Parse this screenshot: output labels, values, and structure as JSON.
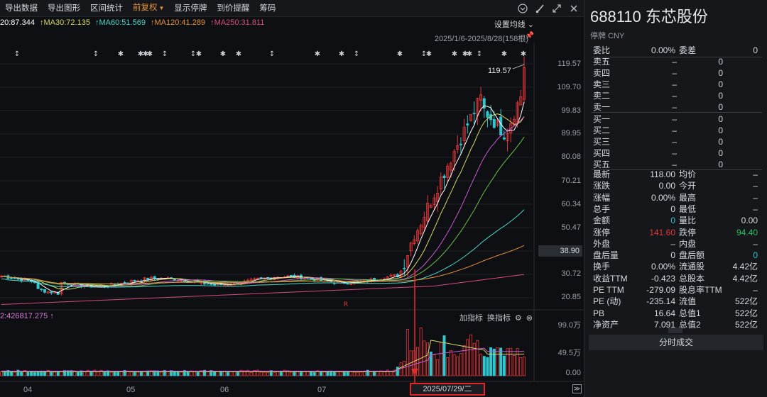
{
  "toolbar": {
    "items": [
      "导出数据",
      "导出图形",
      "区间统计",
      "前复权",
      "显示停牌",
      "到价提醒",
      "筹码"
    ],
    "active_index": 3,
    "icons": [
      "chevron-circle-icon",
      "brush-icon",
      "expand-icon",
      "close-icon"
    ]
  },
  "ma": [
    {
      "label": "20:87.344",
      "color": "#ffffff"
    },
    {
      "label": "↑MA30:72.135",
      "color": "#d7d86a"
    },
    {
      "label": "↑MA60:51.569",
      "color": "#4dd6c8"
    },
    {
      "label": "↑MA120:41.289",
      "color": "#e5923a"
    },
    {
      "label": "↑MA250:31.811",
      "color": "#d94b7c"
    }
  ],
  "settings_ma": "设置均线",
  "date_range": "2025/1/6-2025/8/28(158根)",
  "price_axis": [
    "119.57",
    "109.70",
    "99.83",
    "89.95",
    "80.08",
    "70.21",
    "60.34",
    "50.47",
    "40.59",
    "30.72",
    "20.85"
  ],
  "current_price_tag": "38.90",
  "max_price_label": "119.57",
  "vol_label": "2:426817.275 ↑",
  "vol_tools": {
    "add": "加指标",
    "switch": "换指标"
  },
  "vol_axis": [
    "99.0万",
    "49.5万",
    "0.00"
  ],
  "months": [
    "04",
    "05",
    "06",
    "07"
  ],
  "crosshair_date": "2025/07/29/二",
  "marker_char": "✱",
  "up_marker_char": "↕",
  "r_marker": "R",
  "colors": {
    "up": "#e6383a",
    "down": "#2fc6cf",
    "accent": "#e5923a",
    "green": "#27c25d",
    "red": "#e6383a"
  },
  "stock": {
    "title": "688110 东芯股份",
    "status": "停牌 CNY"
  },
  "order_book": {
    "weibi": {
      "label": "委比",
      "value": "0.00%",
      "label2": "委差",
      "value2": "0"
    },
    "sells": [
      {
        "label": "卖五",
        "price": "–",
        "vol": "0"
      },
      {
        "label": "卖四",
        "price": "–",
        "vol": "0"
      },
      {
        "label": "卖三",
        "price": "–",
        "vol": "0"
      },
      {
        "label": "卖二",
        "price": "–",
        "vol": "0"
      },
      {
        "label": "卖一",
        "price": "–",
        "vol": "0"
      }
    ],
    "buys": [
      {
        "label": "买一",
        "price": "–",
        "vol": "0"
      },
      {
        "label": "买二",
        "price": "–",
        "vol": "0"
      },
      {
        "label": "买三",
        "price": "–",
        "vol": "0"
      },
      {
        "label": "买四",
        "price": "–",
        "vol": "0"
      },
      {
        "label": "买五",
        "price": "–",
        "vol": "0"
      }
    ]
  },
  "quote": [
    {
      "l1": "最新",
      "v1": "118.00",
      "l2": "均价",
      "v2": "–"
    },
    {
      "l1": "涨跌",
      "v1": "0.00",
      "l2": "今开",
      "v2": "–"
    },
    {
      "l1": "涨幅",
      "v1": "0.00%",
      "l2": "最高",
      "v2": "–"
    },
    {
      "l1": "总手",
      "v1": "0",
      "l2": "最低",
      "v2": "–"
    },
    {
      "l1": "金额",
      "v1": "0",
      "l2": "量比",
      "v2": "0.00"
    },
    {
      "l1": "涨停",
      "v1": "141.60",
      "l2": "跌停",
      "v2": "94.40"
    },
    {
      "l1": "外盘",
      "v1": "–",
      "l2": "内盘",
      "v2": "–"
    },
    {
      "l1": "盘后量",
      "v1": "0",
      "l2": "盘后额",
      "v2": "0"
    },
    {
      "l1": "换手",
      "v1": "0.00%",
      "l2": "流通股",
      "v2": "4.42亿"
    },
    {
      "l1": "收益TTM",
      "v1": "-0.423",
      "l2": "总股本",
      "v2": "4.42亿"
    },
    {
      "l1": "PE TTM",
      "v1": "-279.09",
      "l2": "股息率TTM",
      "v2": "–"
    },
    {
      "l1": "PE (动)",
      "v1": "-235.14",
      "l2": "流值",
      "v2": "522亿"
    },
    {
      "l1": "PB",
      "v1": "16.64",
      "l2": "总值1",
      "v2": "522亿"
    },
    {
      "l1": "净资产",
      "v1": "7.091",
      "l2": "总值2",
      "v2": "522亿"
    }
  ],
  "time_trade_label": "分时成交"
}
